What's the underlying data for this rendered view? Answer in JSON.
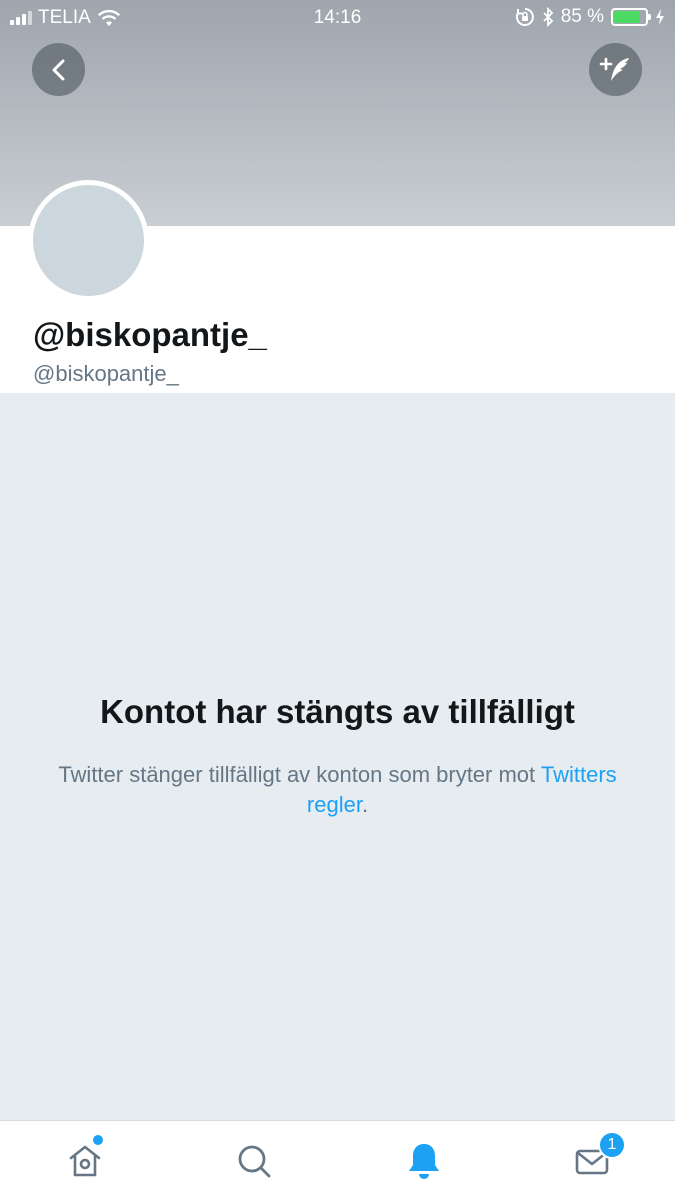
{
  "status_bar": {
    "carrier": "TELIA",
    "time": "14:16",
    "battery": "85 %",
    "battery_level": 0.85,
    "battery_color": "#4cd964"
  },
  "header": {
    "back_icon": "chevron-left-icon",
    "compose_icon": "compose-tweet-icon"
  },
  "profile": {
    "display_name": "@biskopantje_",
    "handle": "@biskopantje_"
  },
  "suspended": {
    "title": "Kontot har stängts av tillfälligt",
    "body": "Twitter stänger tillfälligt av konton som bryter mot ",
    "link_text": "Twitters regler",
    "body_end": "."
  },
  "tabbar": {
    "items": [
      {
        "icon": "home-icon",
        "has_dot": true
      },
      {
        "icon": "search-icon"
      },
      {
        "icon": "bell-icon",
        "active": true
      },
      {
        "icon": "mail-icon",
        "badge": "1"
      }
    ],
    "accent_color": "#1da1f2"
  }
}
